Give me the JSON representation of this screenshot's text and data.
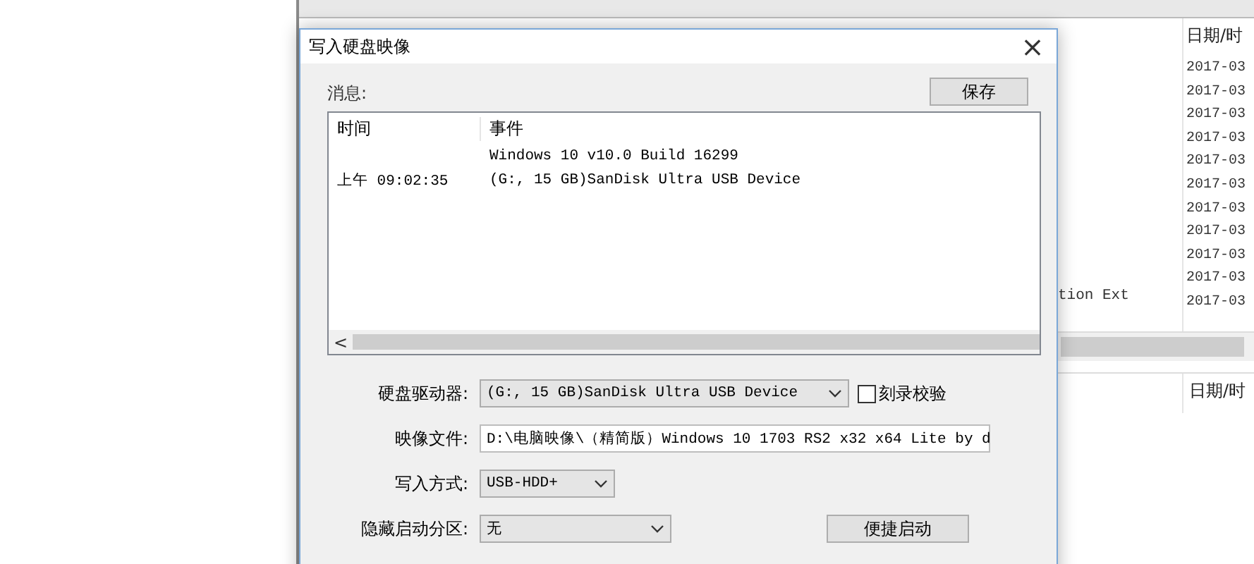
{
  "background_list": {
    "header": "日期/时",
    "dates": [
      "2017-03",
      "2017-03",
      "2017-03",
      "2017-03",
      "2017-03",
      "2017-03",
      "2017-03",
      "2017-03",
      "2017-03",
      "2017-03",
      "2017-03"
    ],
    "name_fragment": "tion Ext",
    "lower_header": "日期/时"
  },
  "dialog": {
    "title": "写入硬盘映像",
    "close": "×",
    "messages_label": "消息:",
    "save_button": "保存",
    "log": {
      "columns": [
        "时间",
        "事件"
      ],
      "rows": [
        {
          "time": "",
          "event": "Windows 10 v10.0 Build 16299"
        },
        {
          "time": "上午 09:02:35",
          "event": "(G:, 15 GB)SanDisk Ultra USB Device"
        }
      ],
      "scroll_left": "<"
    },
    "fields": [
      {
        "kind": "select",
        "label": "硬盘驱动器:",
        "value": "(G:, 15 GB)SanDisk Ultra USB Device",
        "checkbox": {
          "label": "刻录校验",
          "checked": false
        }
      },
      {
        "kind": "text",
        "label": "映像文件:",
        "value": "D:\\电脑映像\\（精简版）Windows 10 1703 RS2 x32 x64 Lite by d"
      },
      {
        "kind": "select",
        "label": "写入方式:",
        "value": "USB-HDD+"
      },
      {
        "kind": "select",
        "label": "隐藏启动分区:",
        "value": "无",
        "button": "便捷启动"
      }
    ]
  }
}
